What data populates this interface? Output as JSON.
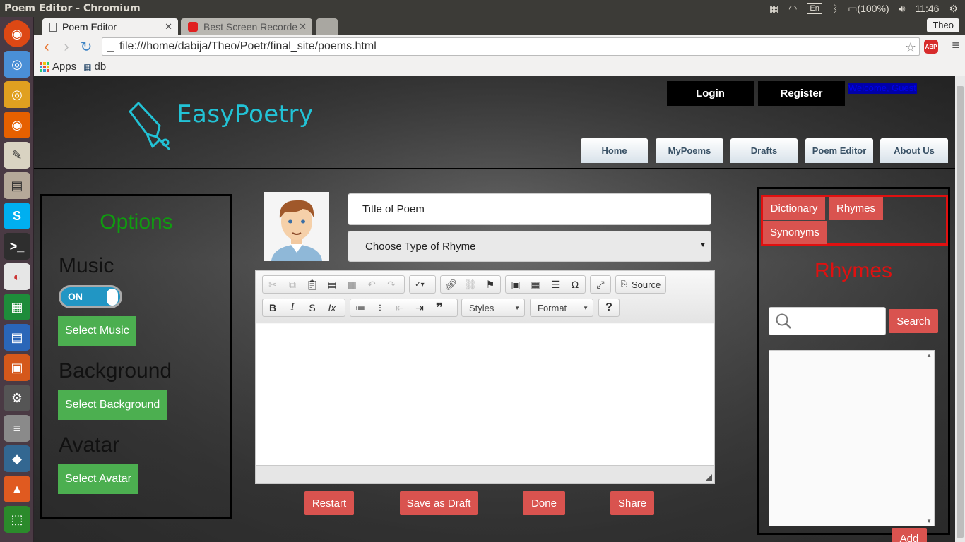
{
  "os": {
    "window_title": "Poem Editor - Chromium",
    "language": "En",
    "battery": "(100%)",
    "time": "11:46"
  },
  "browser": {
    "tabs": [
      {
        "label": "Poem Editor"
      },
      {
        "label": "Best Screen Recorde"
      }
    ],
    "profile": "Theo",
    "url": "file:///home/dabija/Theo/Poetr/final_site/poems.html",
    "abp_label": "ABP",
    "bookmarks": [
      {
        "label": "Apps"
      },
      {
        "label": "db"
      }
    ]
  },
  "header": {
    "logo_text": "EasyPoetry",
    "login_label": "Login",
    "register_label": "Register",
    "welcome_text": "Welcome, Guest",
    "nav": [
      {
        "label": "Home"
      },
      {
        "label": "MyPoems"
      },
      {
        "label": "Drafts"
      },
      {
        "label": "Poem Editor"
      },
      {
        "label": "About Us"
      }
    ]
  },
  "options": {
    "title": "Options",
    "music_heading": "Music",
    "music_toggle": "ON",
    "select_music": "Select Music",
    "background_heading": "Background",
    "select_background": "Select Background",
    "avatar_heading": "Avatar",
    "select_avatar": "Select Avatar"
  },
  "editor": {
    "title_placeholder": "Title of Poem",
    "rhyme_select": "Choose Type of Rhyme",
    "source_label": "Source",
    "styles_label": "Styles",
    "format_label": "Format",
    "help_label": "?"
  },
  "actions": {
    "restart": "Restart",
    "save_draft": "Save as Draft",
    "done": "Done",
    "share": "Share"
  },
  "rhymes_panel": {
    "tabs": [
      {
        "label": "Dictionary"
      },
      {
        "label": "Rhymes"
      },
      {
        "label": "Synonyms"
      }
    ],
    "title": "Rhymes",
    "search_button": "Search",
    "add_button": "Add"
  },
  "colors": {
    "accent_green": "#4caf50",
    "accent_red": "#d9534f",
    "logo_cyan": "#22c3d6",
    "options_title": "#0f9d0f",
    "rhymes_title": "#e01010"
  }
}
